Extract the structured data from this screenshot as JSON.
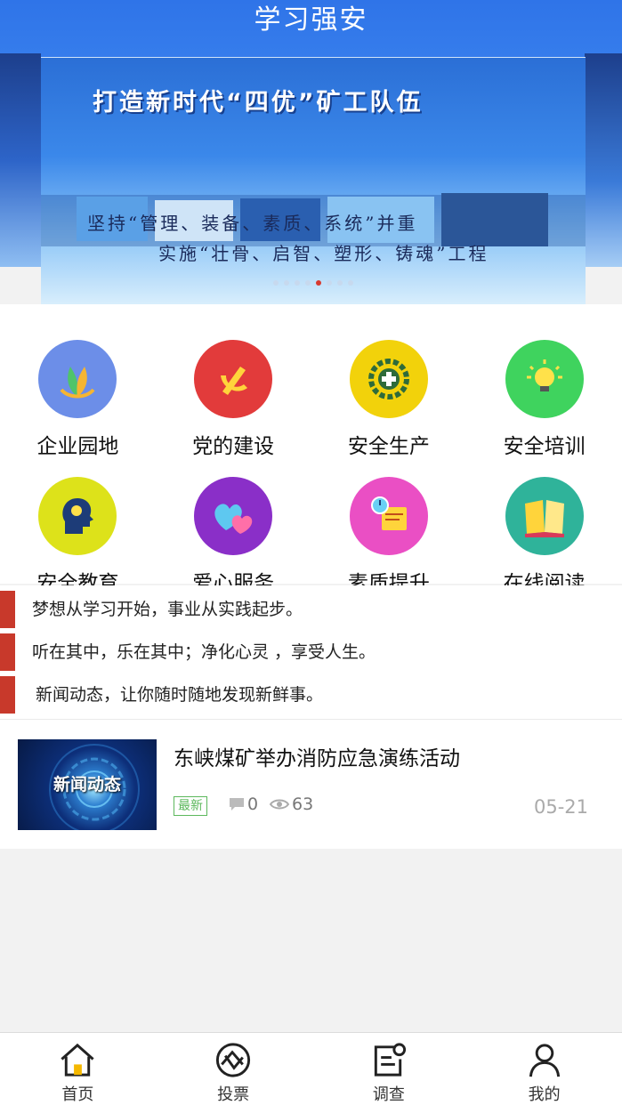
{
  "header": {
    "title": "学习强安"
  },
  "banner": {
    "headline": "打造新时代“四优”矿工队伍",
    "line1": "坚持“管理、装备、素质、系统”并重",
    "line2": "实施“壮骨、启智、塑形、铸魂”工程",
    "slide_count": 8,
    "active_slide": 4
  },
  "grid": [
    {
      "label": "企业园地",
      "icon": "plant-icon",
      "color": "#6c8ee8"
    },
    {
      "label": "党的建设",
      "icon": "party-emblem-icon",
      "color": "#e23b3b"
    },
    {
      "label": "安全生产",
      "icon": "safety-gear-icon",
      "color": "#f2d20b"
    },
    {
      "label": "安全培训",
      "icon": "lightbulb-icon",
      "color": "#3fd35e"
    },
    {
      "label": "安全教育",
      "icon": "head-idea-icon",
      "color": "#dde21a"
    },
    {
      "label": "爱心服务",
      "icon": "hearts-icon",
      "color": "#8a2fc8"
    },
    {
      "label": "素质提升",
      "icon": "certificate-clock-icon",
      "color": "#ea4fc4"
    },
    {
      "label": "在线阅读",
      "icon": "open-book-icon",
      "color": "#2fb39a"
    }
  ],
  "notices": [
    "梦想从学习开始，事业从实践起步。",
    "听在其中，乐在其中；净化心灵 ，享受人生。",
    "新闻动态，让你随时随地发现新鲜事。"
  ],
  "news": {
    "thumb_text": "新闻动态",
    "title": "东峡煤矿举办消防应急演练活动",
    "tag": "最新",
    "comments": "0",
    "views": "63",
    "date": "05-21"
  },
  "tabs": [
    {
      "label": "首页",
      "icon": "home-icon"
    },
    {
      "label": "投票",
      "icon": "vote-icon"
    },
    {
      "label": "调查",
      "icon": "survey-icon"
    },
    {
      "label": "我的",
      "icon": "user-icon"
    }
  ],
  "colors": {
    "accent_red": "#c8392b",
    "tag_green": "#5cb85c",
    "header_blue": "#2f74e8"
  }
}
